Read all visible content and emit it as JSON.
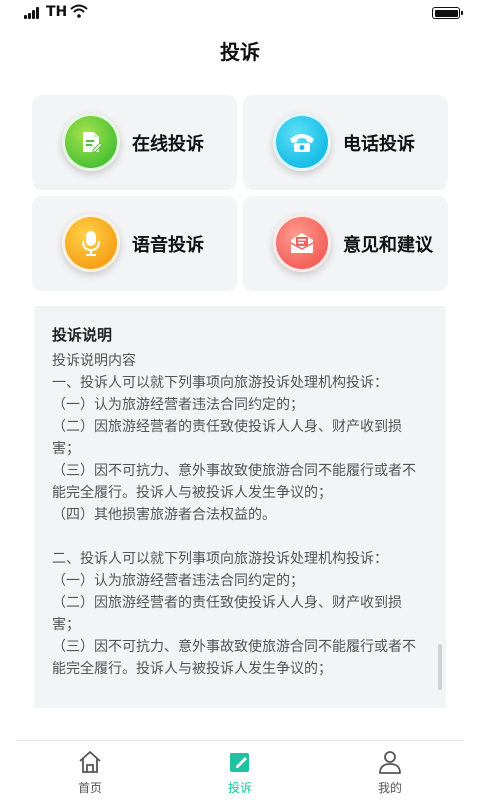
{
  "status_bar": {
    "carrier": "TH"
  },
  "header": {
    "title": "投诉"
  },
  "options": [
    {
      "label": "在线投诉",
      "icon": "edit-document-icon"
    },
    {
      "label": "电话投诉",
      "icon": "telephone-icon"
    },
    {
      "label": "语音投诉",
      "icon": "microphone-icon"
    },
    {
      "label": "意见和建议",
      "icon": "mailbox-icon"
    }
  ],
  "explanation": {
    "title": "投诉说明",
    "lines": [
      "投诉说明内容",
      "一、投诉人可以就下列事项向旅游投诉处理机构投诉：",
      "（一）认为旅游经营者违法合同约定的；",
      "（二）因旅游经营者的责任致使投诉人人身、财产收到损害；",
      "（三）因不可抗力、意外事故致使旅游合同不能履行或者不能完全履行。投诉人与被投诉人发生争议的；",
      "（四）其他损害旅游者合法权益的。",
      "",
      "二、投诉人可以就下列事项向旅游投诉处理机构投诉：",
      "（一）认为旅游经营者违法合同约定的；",
      "（二）因旅游经营者的责任致使投诉人人身、财产收到损害；",
      "（三）因不可抗力、意外事故致使旅游合同不能履行或者不能完全履行。投诉人与被投诉人发生争议的；"
    ]
  },
  "tabbar": {
    "items": [
      {
        "label": "首页",
        "icon": "home-icon"
      },
      {
        "label": "投诉",
        "icon": "edit-icon",
        "active": true
      },
      {
        "label": "我的",
        "icon": "user-icon"
      }
    ],
    "active_color": "#1fc3a2"
  }
}
